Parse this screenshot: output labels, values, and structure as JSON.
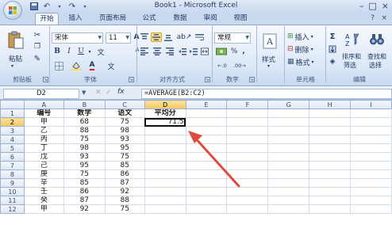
{
  "window": {
    "title": "Book1 - Microsoft Excel",
    "controls": [
      "–",
      "□",
      "×"
    ]
  },
  "tabs": [
    {
      "label": "开始",
      "active": true
    },
    {
      "label": "插入",
      "active": false
    },
    {
      "label": "页面布局",
      "active": false
    },
    {
      "label": "公式",
      "active": false
    },
    {
      "label": "数据",
      "active": false
    },
    {
      "label": "审阅",
      "active": false
    },
    {
      "label": "视图",
      "active": false
    }
  ],
  "ribbon": {
    "clipboard": {
      "paste": "粘贴",
      "label": "剪贴板"
    },
    "font": {
      "name": "宋体",
      "size": "11",
      "bold": "B",
      "italic": "I",
      "underline": "U",
      "grow": "A",
      "shrink": "A",
      "font_color": "A",
      "char": "文",
      "label": "字体"
    },
    "alignment": {
      "label": "对齐方式"
    },
    "number": {
      "format": "常规",
      "percent": "%",
      "comma": ",",
      "label": "数字"
    },
    "styles": {
      "label": "样式"
    },
    "cells": {
      "insert": "插入",
      "delete": "删除",
      "format": "格式",
      "label": "单元格"
    },
    "editing": {
      "sigma": "Σ",
      "sort": "排序和",
      "sort2": "筛选",
      "find": "查找和",
      "find2": "选择",
      "label": "编辑"
    }
  },
  "formula_bar": {
    "name_box": "D2",
    "fx": "fx",
    "formula": "=AVERAGE(B2:C2)"
  },
  "sheet": {
    "columns": [
      "A",
      "B",
      "C",
      "D",
      "E",
      "F",
      "G",
      "H",
      "I"
    ],
    "selected_column": "D",
    "selected_row": "2",
    "header_row": [
      "编号",
      "数学",
      "语文",
      "平均分"
    ],
    "rows": [
      [
        "1",
        "编号",
        "数学",
        "语文",
        "平均分"
      ],
      [
        "2",
        "甲",
        "68",
        "75",
        "71.5"
      ],
      [
        "3",
        "乙",
        "88",
        "98",
        ""
      ],
      [
        "4",
        "丙",
        "75",
        "93",
        ""
      ],
      [
        "5",
        "丁",
        "98",
        "95",
        ""
      ],
      [
        "6",
        "戊",
        "93",
        "75",
        ""
      ],
      [
        "7",
        "己",
        "95",
        "85",
        ""
      ],
      [
        "8",
        "庚",
        "75",
        "86",
        ""
      ],
      [
        "9",
        "辛",
        "85",
        "87",
        ""
      ],
      [
        "10",
        "壬",
        "86",
        "92",
        ""
      ],
      [
        "11",
        "癸",
        "87",
        "88",
        ""
      ],
      [
        "12",
        "甲",
        "92",
        "75",
        ""
      ]
    ]
  },
  "colors": {
    "arrow": "#e04b3c",
    "ribbon_border": "#8da7c9",
    "selected_header": "#f3c760"
  }
}
